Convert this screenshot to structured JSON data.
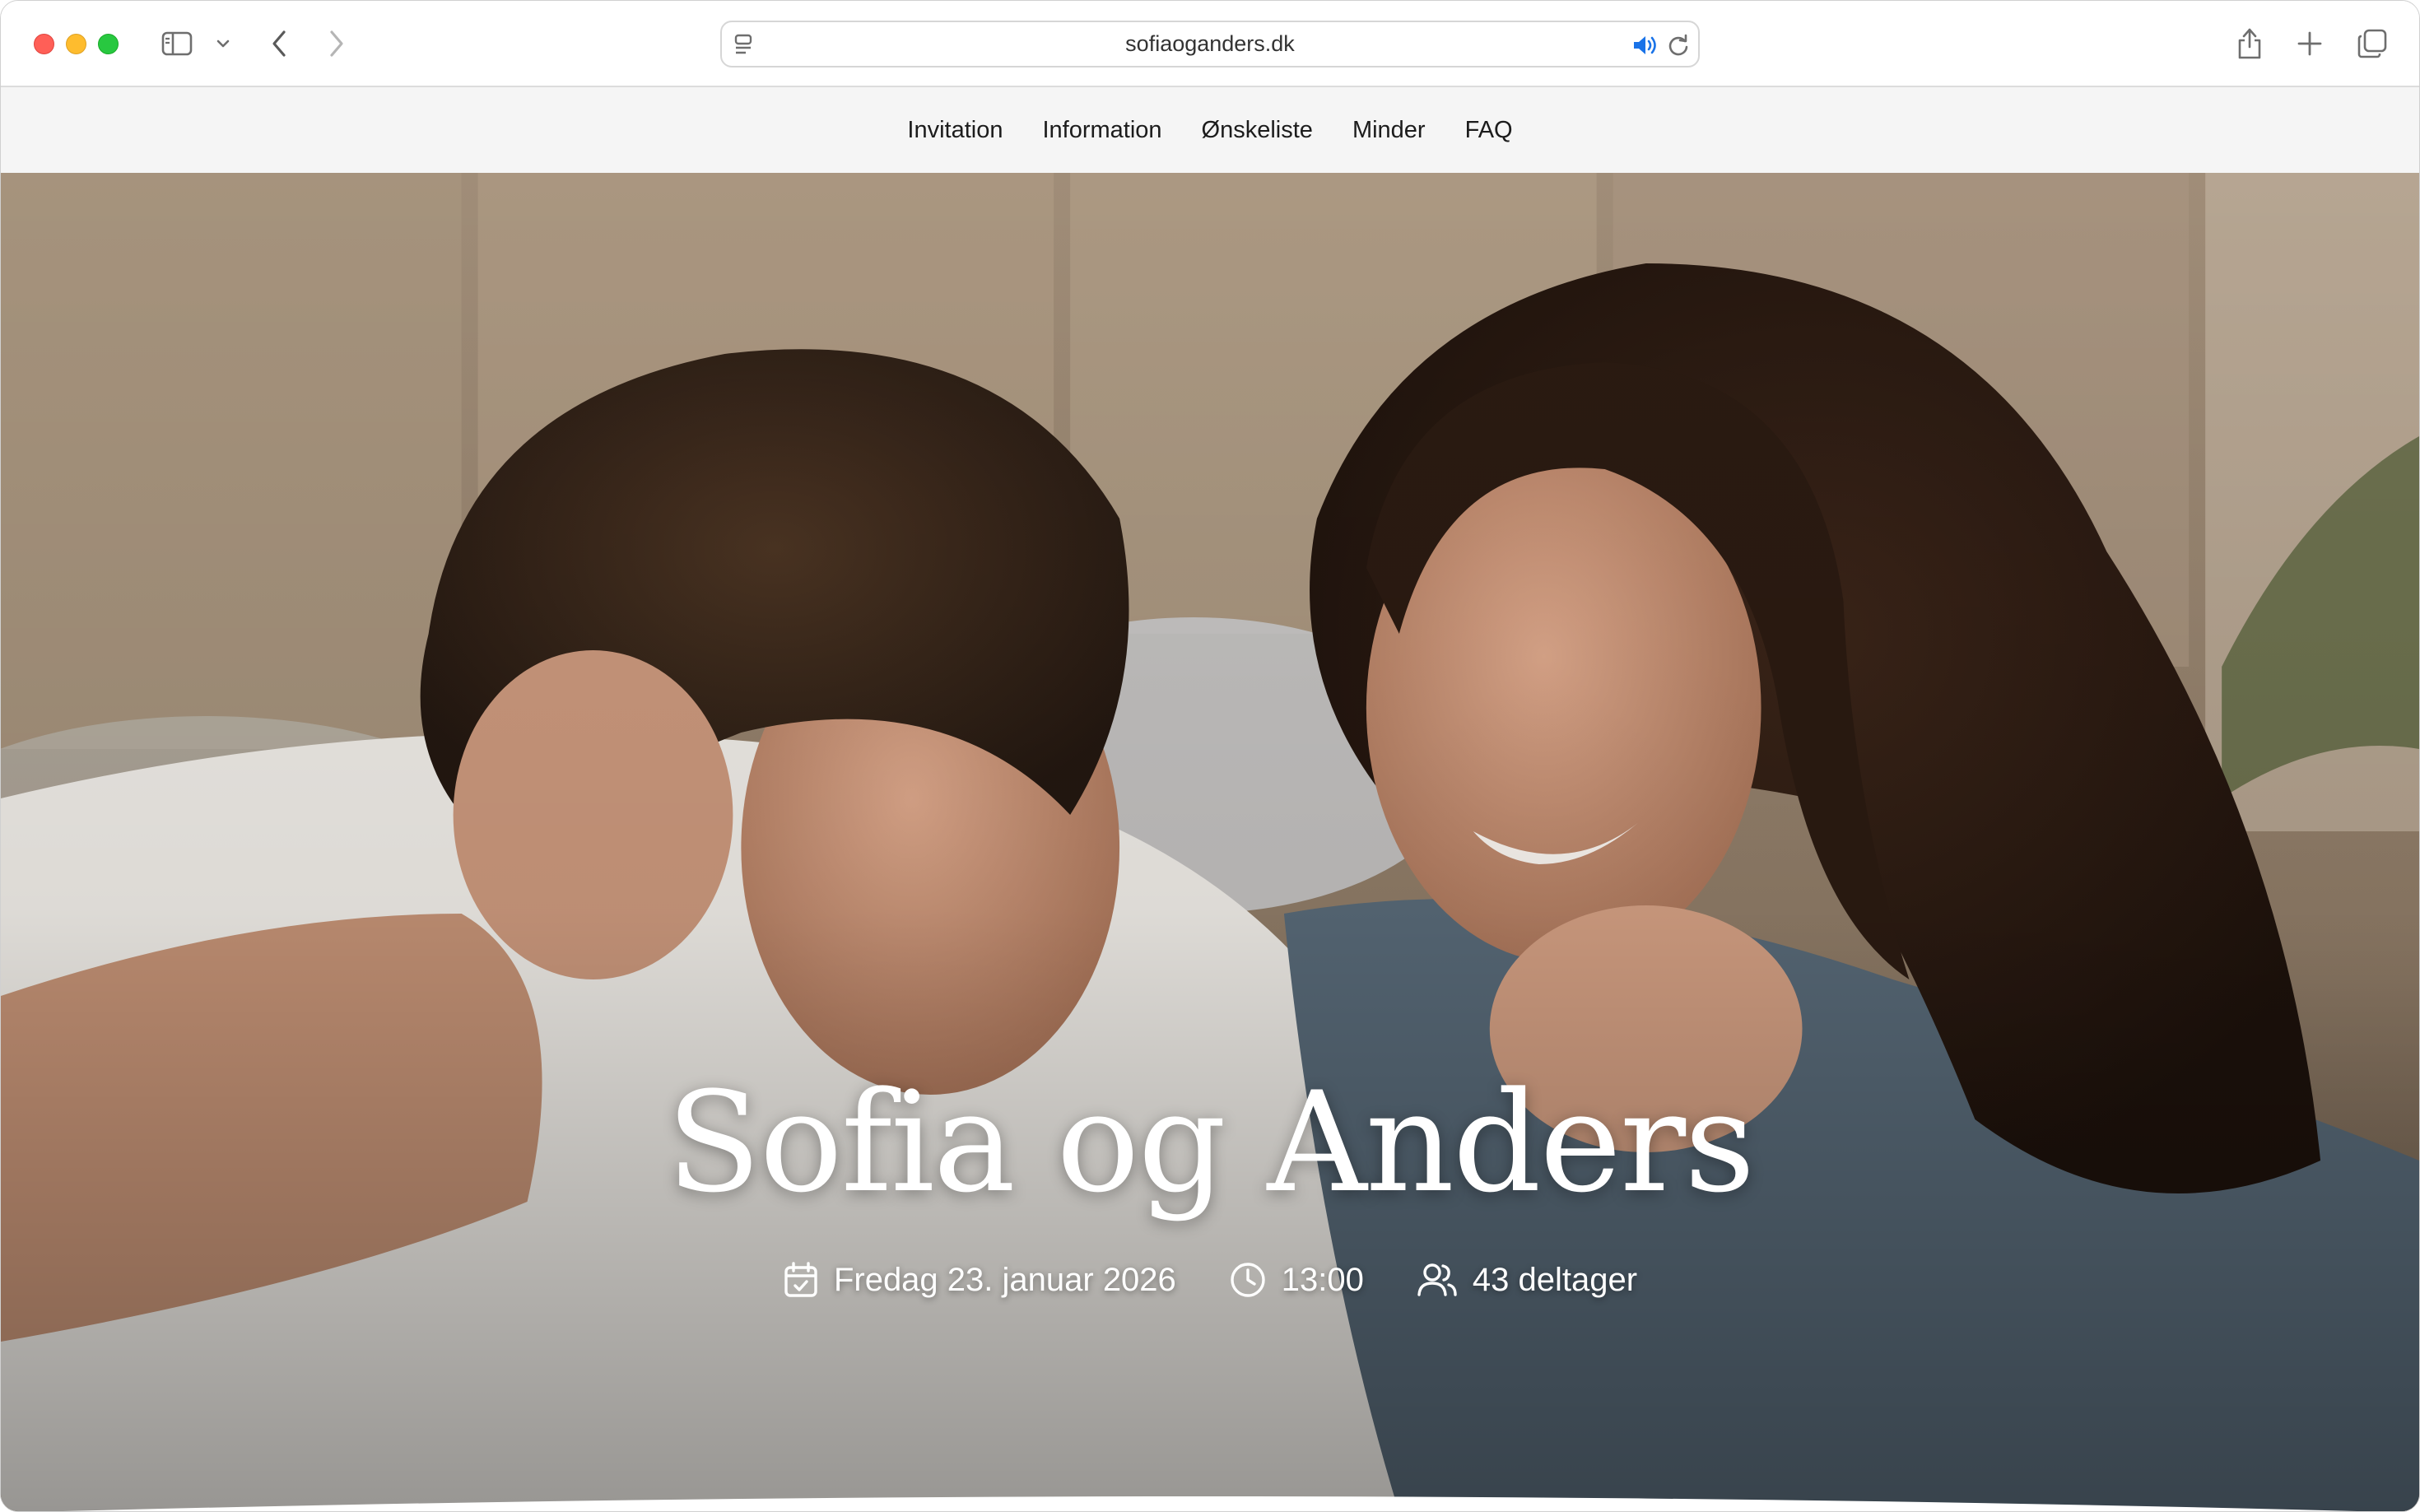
{
  "browser": {
    "url": "sofiaoganders.dk",
    "icons": [
      "sidebar-icon",
      "chevron-down-icon",
      "back-arrow-icon",
      "forward-arrow-icon",
      "page-menu-icon",
      "speaker-icon",
      "reload-icon",
      "share-icon",
      "plus-icon",
      "tabs-overview-icon"
    ]
  },
  "nav": {
    "items": [
      "Invitation",
      "Information",
      "Ønskeliste",
      "Minder",
      "FAQ"
    ]
  },
  "hero": {
    "title": "Sofia og Anders",
    "date": "Fredag 23. januar 2026",
    "time": "13:00",
    "participants": "43 deltager"
  },
  "colors": {
    "traffic_red": "#ff5f57",
    "traffic_yellow": "#febc2e",
    "traffic_green": "#28c840",
    "speaker_blue": "#1a73e8",
    "hero_text": "#ffffff"
  }
}
